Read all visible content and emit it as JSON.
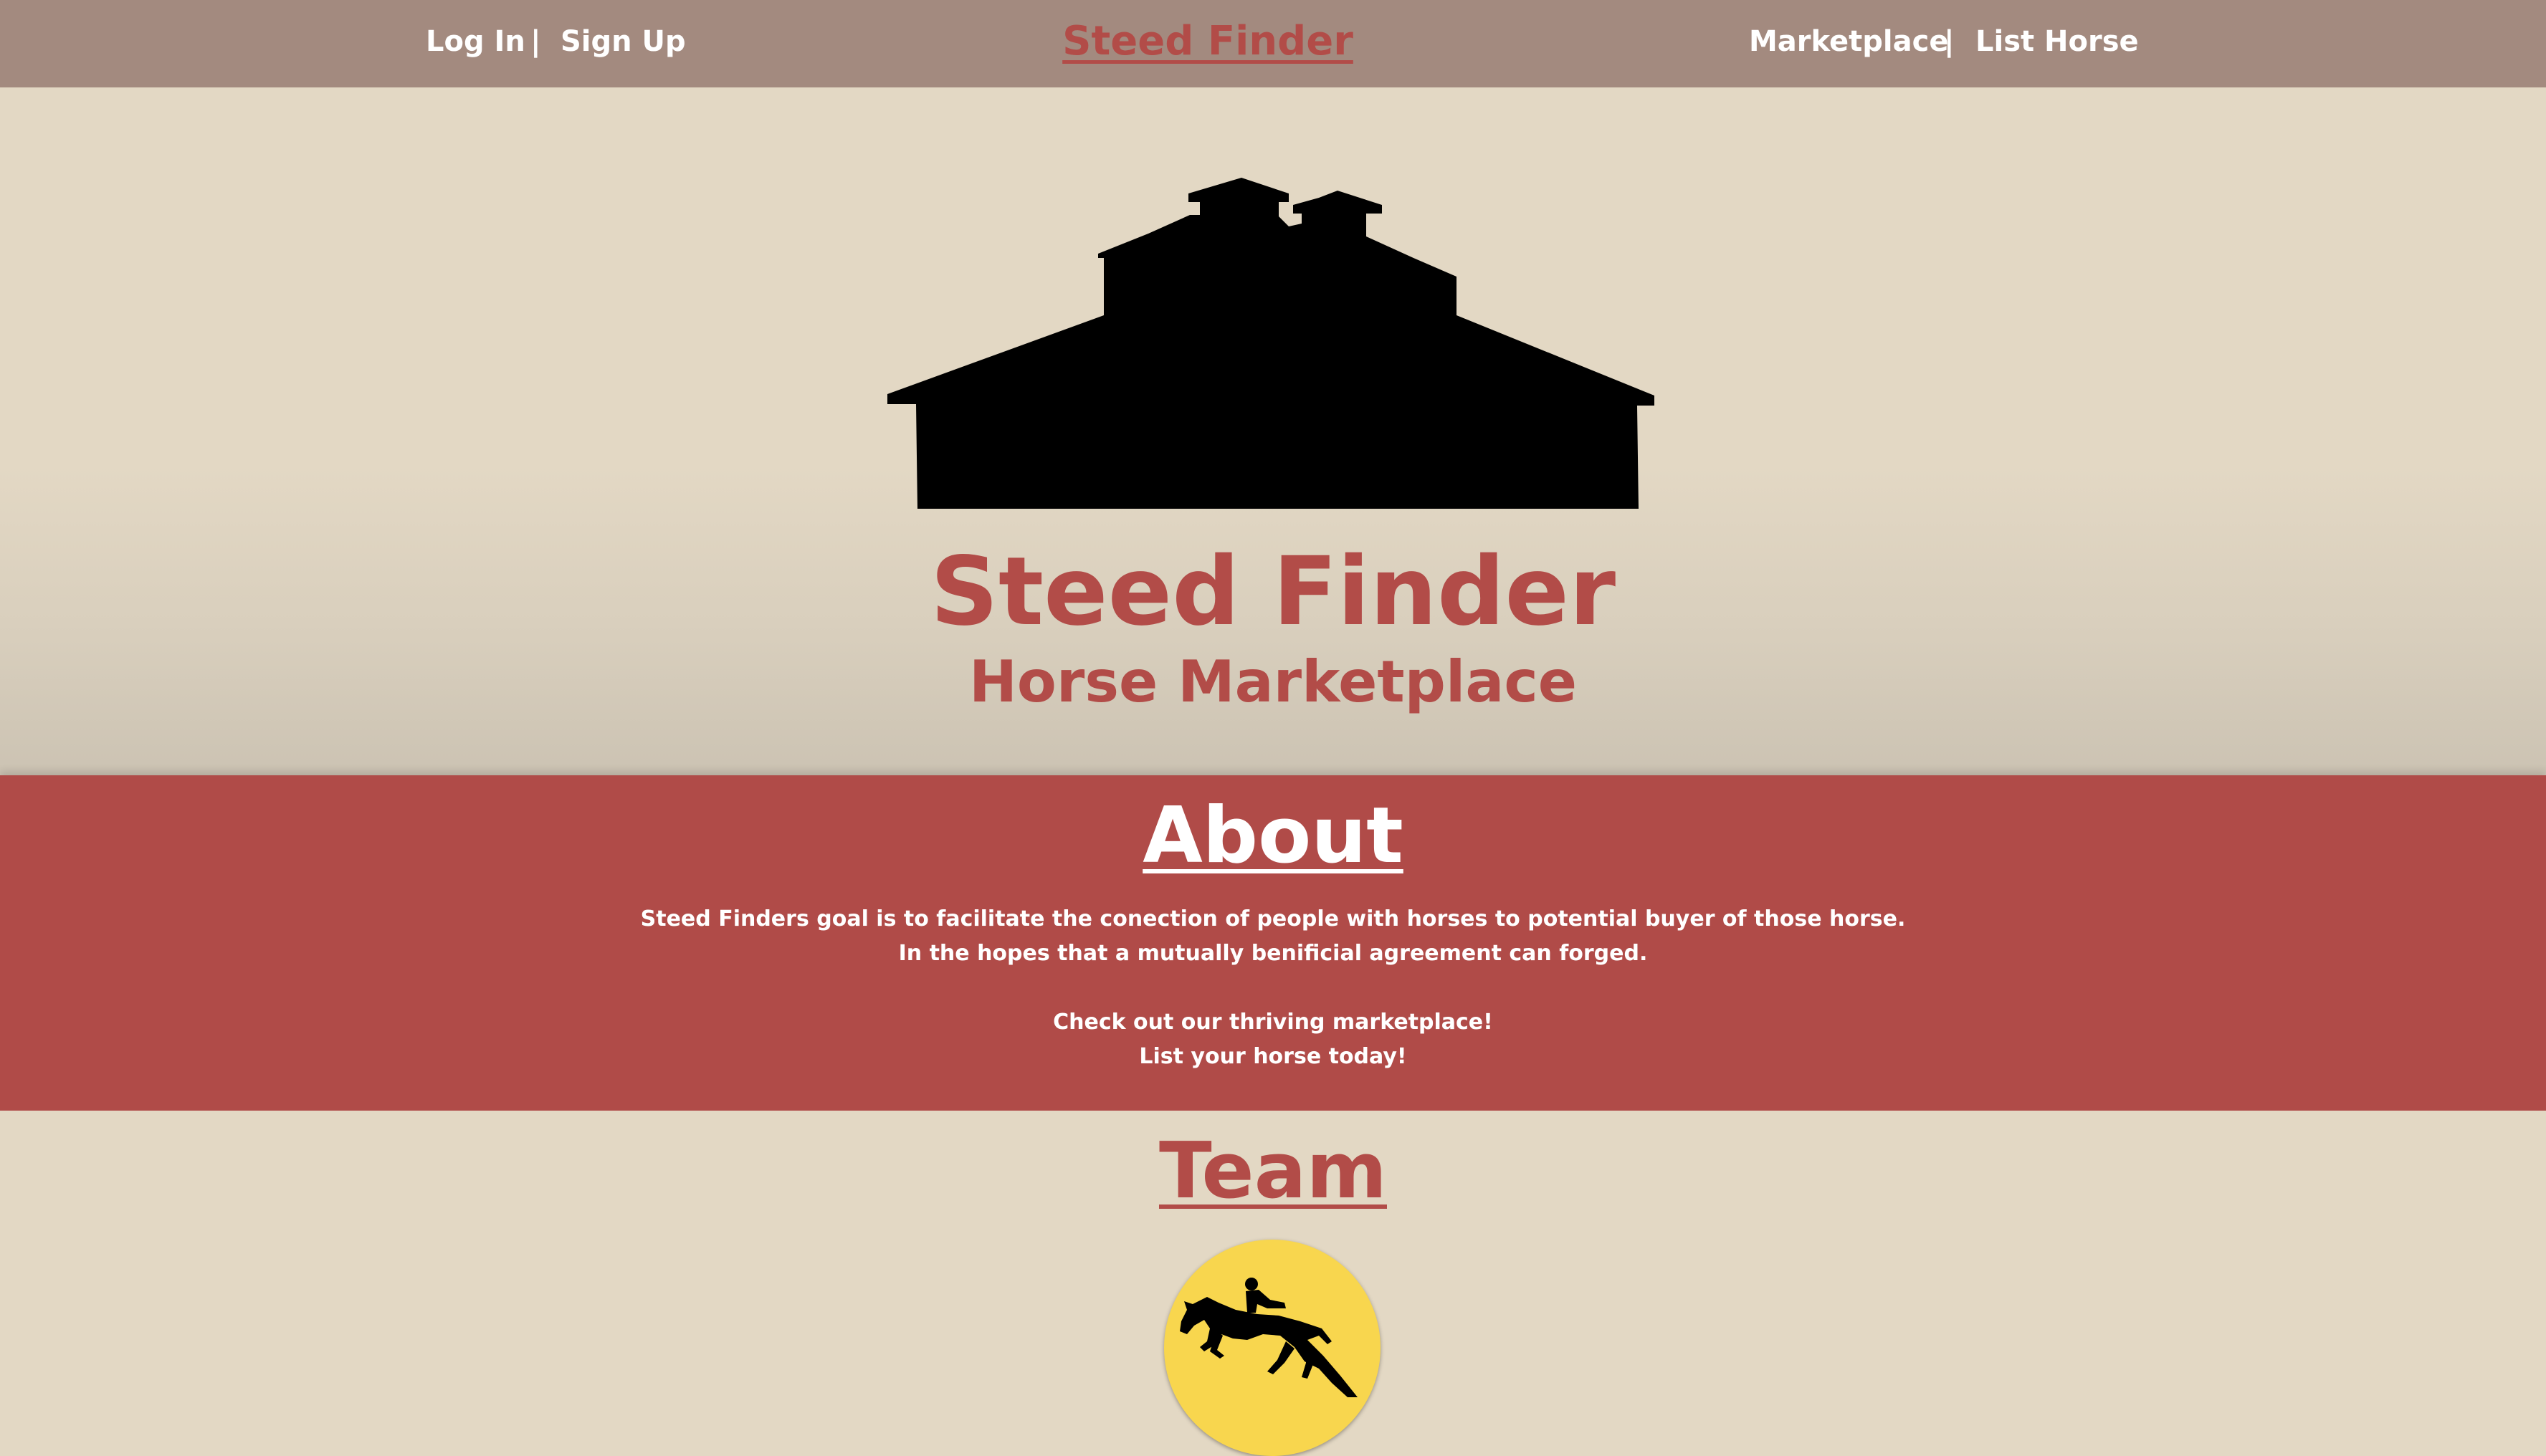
{
  "nav": {
    "login": "Log In",
    "separator_left": "|",
    "signup": "Sign Up",
    "brand": "Steed Finder",
    "marketplace": "Marketplace",
    "separator_right": "|",
    "list_horse": "List Horse"
  },
  "hero": {
    "logo_icon": "barn-icon",
    "title": "Steed Finder",
    "subtitle": "Horse Marketplace"
  },
  "about": {
    "heading": "About",
    "lines": [
      "Steed Finders goal is to facilitate the conection of people with horses to potential buyer of those horse.",
      "In the hopes that a mutually benificial agreement can forged.",
      "Check out our thriving marketplace!",
      "List your horse today!"
    ]
  },
  "team": {
    "heading": "Team",
    "avatar_icon": "show-jumping-horse-icon"
  },
  "colors": {
    "nav_bg": "#a38a7f",
    "page_bg": "#e3d8c4",
    "accent_red": "#b04b48",
    "avatar_yellow": "#f8d64e"
  }
}
